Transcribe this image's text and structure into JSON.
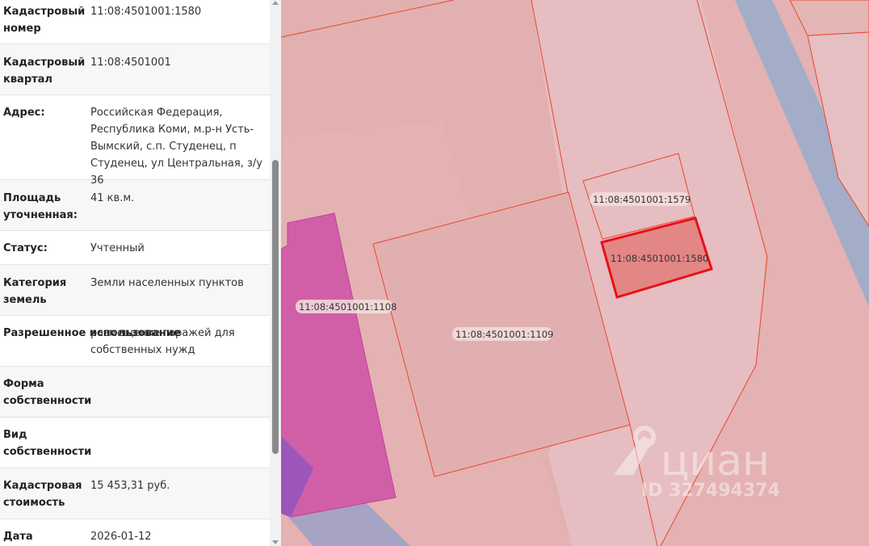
{
  "info_panel": {
    "rows": [
      {
        "label": "Кадастровый номер",
        "value": "11:08:4501001:1580"
      },
      {
        "label": "Кадастровый квартал",
        "value": "11:08:4501001"
      },
      {
        "label": "Адрес:",
        "value": "Российская Федерация, Республика Коми, м.р-н Усть-Вымский, с.п. Студенец, п Студенец, ул Центральная, з/у 36"
      },
      {
        "label": "Площадь уточненная:",
        "value": "41 кв.м."
      },
      {
        "label": "Статус:",
        "value": "Учтенный"
      },
      {
        "label": "Категория земель",
        "value": "Земли населенных пунктов"
      },
      {
        "label": "Разрешенное использование",
        "value": "размещение гаражей для собственных нужд"
      },
      {
        "label": "Форма собственности",
        "value": ""
      },
      {
        "label": "Вид собственности",
        "value": ""
      },
      {
        "label": "Кадастровая стоимость",
        "value": "15 453,31 руб."
      },
      {
        "label": "Дата",
        "value": "2026-01-12"
      }
    ]
  },
  "map": {
    "parcels": [
      {
        "id": "p1108",
        "label": "11:08:4501001:1108"
      },
      {
        "id": "p1109",
        "label": "11:08:4501001:1109"
      },
      {
        "id": "p1579",
        "label": "11:08:4501001:1579"
      },
      {
        "id": "p1580",
        "label": "11:08:4501001:1580",
        "selected": true
      }
    ],
    "watermark": {
      "brand": "циан",
      "listing_id": "ID 327494374"
    },
    "colors": {
      "parcel_fill": "#e2aeae",
      "parcel_stroke": "#e8472e",
      "selected_stroke": "#e8101a",
      "magenta_zone": "#d060a8",
      "road": "#a4aec8"
    }
  }
}
